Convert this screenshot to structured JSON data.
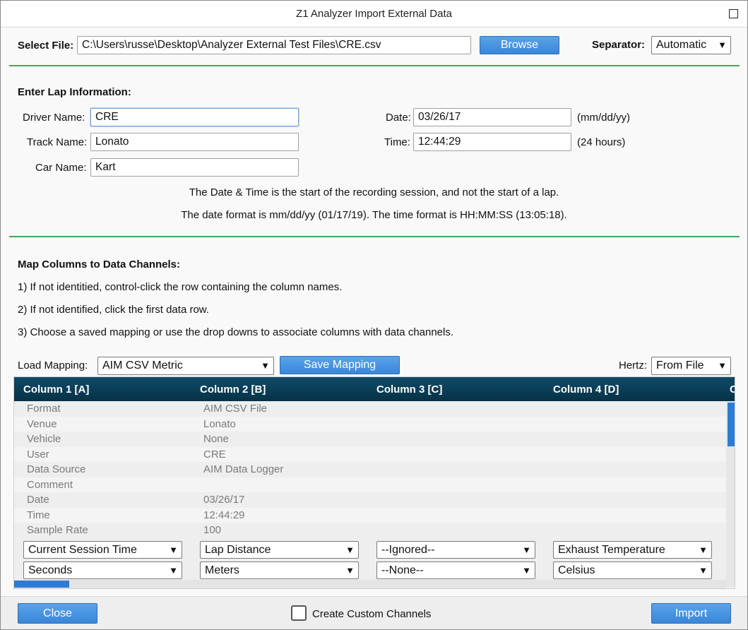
{
  "window": {
    "title": "Z1 Analyzer Import External Data"
  },
  "file": {
    "label": "Select File:",
    "path": "C:\\Users\\russe\\Desktop\\Analyzer External Test Files\\CRE.csv",
    "browse_label": "Browse",
    "separator_label": "Separator:",
    "separator_value": "Automatic"
  },
  "lap": {
    "heading": "Enter Lap Information:",
    "driver_label": "Driver Name:",
    "driver_value": "CRE",
    "track_label": "Track Name:",
    "track_value": "Lonato",
    "car_label": "Car Name:",
    "car_value": "Kart",
    "date_label": "Date:",
    "date_value": "03/26/17",
    "date_hint": "(mm/dd/yy)",
    "time_label": "Time:",
    "time_value": "12:44:29",
    "time_hint": "(24 hours)",
    "note1": "The Date & Time is the start of the recording session, and not the start of a lap.",
    "note2": "The date format is mm/dd/yy (01/17/19). The time format is HH:MM:SS (13:05:18)."
  },
  "mapping": {
    "heading": "Map Columns to Data Channels:",
    "step1": "1) If not identitied, control-click the row containing the column names.",
    "step2": "2) If not identified, click the first data row.",
    "step3": "3) Choose a saved mapping or use the drop downs to associate columns with data channels.",
    "load_label": "Load Mapping:",
    "load_value": "AIM CSV Metric",
    "save_label": "Save Mapping",
    "hertz_label": "Hertz:",
    "hertz_value": "From File"
  },
  "grid": {
    "columns": [
      "Column 1 [A]",
      "Column 2 [B]",
      "Column 3 [C]",
      "Column 4 [D]",
      "C"
    ],
    "rows": [
      [
        "Format",
        "AIM CSV File"
      ],
      [
        "Venue",
        "Lonato"
      ],
      [
        "Vehicle",
        "None"
      ],
      [
        "User",
        "CRE"
      ],
      [
        "Data Source",
        "AIM Data Logger"
      ],
      [
        "Comment",
        ""
      ],
      [
        "Date",
        "03/26/17"
      ],
      [
        "Time",
        "12:44:29"
      ],
      [
        "Sample Rate",
        "100"
      ]
    ],
    "channels": [
      "Current Session Time",
      "Lap Distance",
      "--Ignored--",
      "Exhaust Temperature"
    ],
    "units": [
      "Seconds",
      "Meters",
      "--None--",
      "Celsius"
    ]
  },
  "footer": {
    "close_label": "Close",
    "custom_label": "Create Custom Channels",
    "import_label": "Import"
  },
  "colors": {
    "accent": "#3a86d8",
    "divider": "#4aa35a",
    "grid_header": "#0b3f58"
  }
}
